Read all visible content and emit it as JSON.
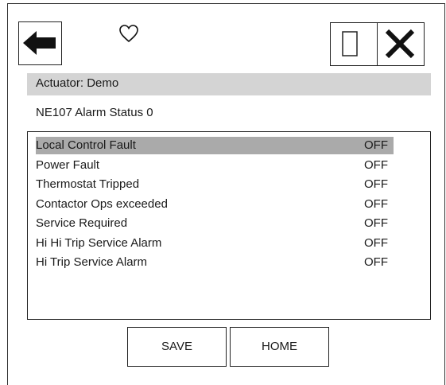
{
  "header": {
    "actuator_label": "Actuator: Demo",
    "title": "NE107 Alarm Status 0"
  },
  "icons": {
    "back": "back-arrow-icon",
    "favorite": "heart-icon",
    "square": "square-icon",
    "close": "close-icon"
  },
  "alarms": [
    {
      "label": "Local Control Fault",
      "value": "OFF",
      "selected": true
    },
    {
      "label": "Power Fault",
      "value": "OFF",
      "selected": false
    },
    {
      "label": "Thermostat Tripped",
      "value": "OFF",
      "selected": false
    },
    {
      "label": "Contactor Ops exceeded",
      "value": "OFF",
      "selected": false
    },
    {
      "label": "Service Required",
      "value": "OFF",
      "selected": false
    },
    {
      "label": "Hi Hi Trip Service Alarm",
      "value": "OFF",
      "selected": false
    },
    {
      "label": "Hi Trip Service Alarm",
      "value": "OFF",
      "selected": false
    }
  ],
  "footer": {
    "save_label": "SAVE",
    "home_label": "HOME"
  },
  "colors": {
    "selected_row": "#aaaaaa",
    "header_bar": "#d4d4d4"
  }
}
